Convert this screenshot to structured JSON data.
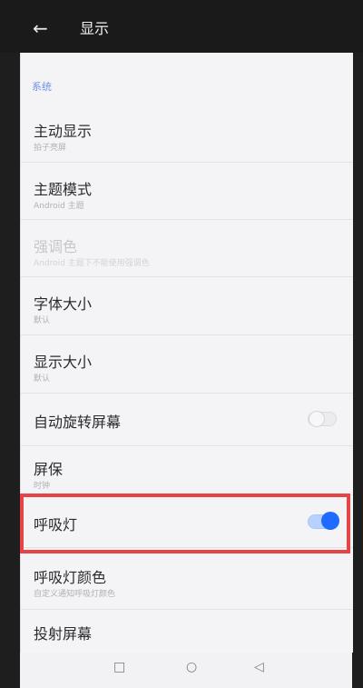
{
  "header": {
    "back_icon": "back-arrow-icon",
    "title": "显示"
  },
  "section": {
    "label": "系统"
  },
  "items": [
    {
      "title": "主动显示",
      "subtitle": "拍子亮屏",
      "state": "enabled"
    },
    {
      "title": "主题模式",
      "subtitle": "Android 主题",
      "state": "enabled"
    },
    {
      "title": "强调色",
      "subtitle": "Android 主题下不能使用强调色",
      "state": "disabled"
    },
    {
      "title": "字体大小",
      "subtitle": "默认",
      "state": "enabled"
    },
    {
      "title": "显示大小",
      "subtitle": "默认",
      "state": "enabled"
    },
    {
      "title": "自动旋转屏幕",
      "subtitle": "",
      "toggle": "off"
    },
    {
      "title": "屏保",
      "subtitle": "时钟",
      "state": "enabled"
    },
    {
      "title": "呼吸灯",
      "subtitle": "",
      "toggle": "on",
      "highlighted": true
    },
    {
      "title": "呼吸灯颜色",
      "subtitle": "自定义通知呼吸灯颜色",
      "state": "enabled"
    },
    {
      "title": "投射屏幕",
      "subtitle": "",
      "state": "enabled"
    }
  ],
  "colors": {
    "accent": "#1f6bff",
    "highlight_border": "#e64545",
    "section_label": "#6f92e8",
    "panel_bg": "#f4f4f7",
    "header_bg": "#1a1a1a"
  },
  "navigation": {
    "recent_icon": "square-icon",
    "home_icon": "circle-icon",
    "back_icon": "triangle-back-icon"
  }
}
